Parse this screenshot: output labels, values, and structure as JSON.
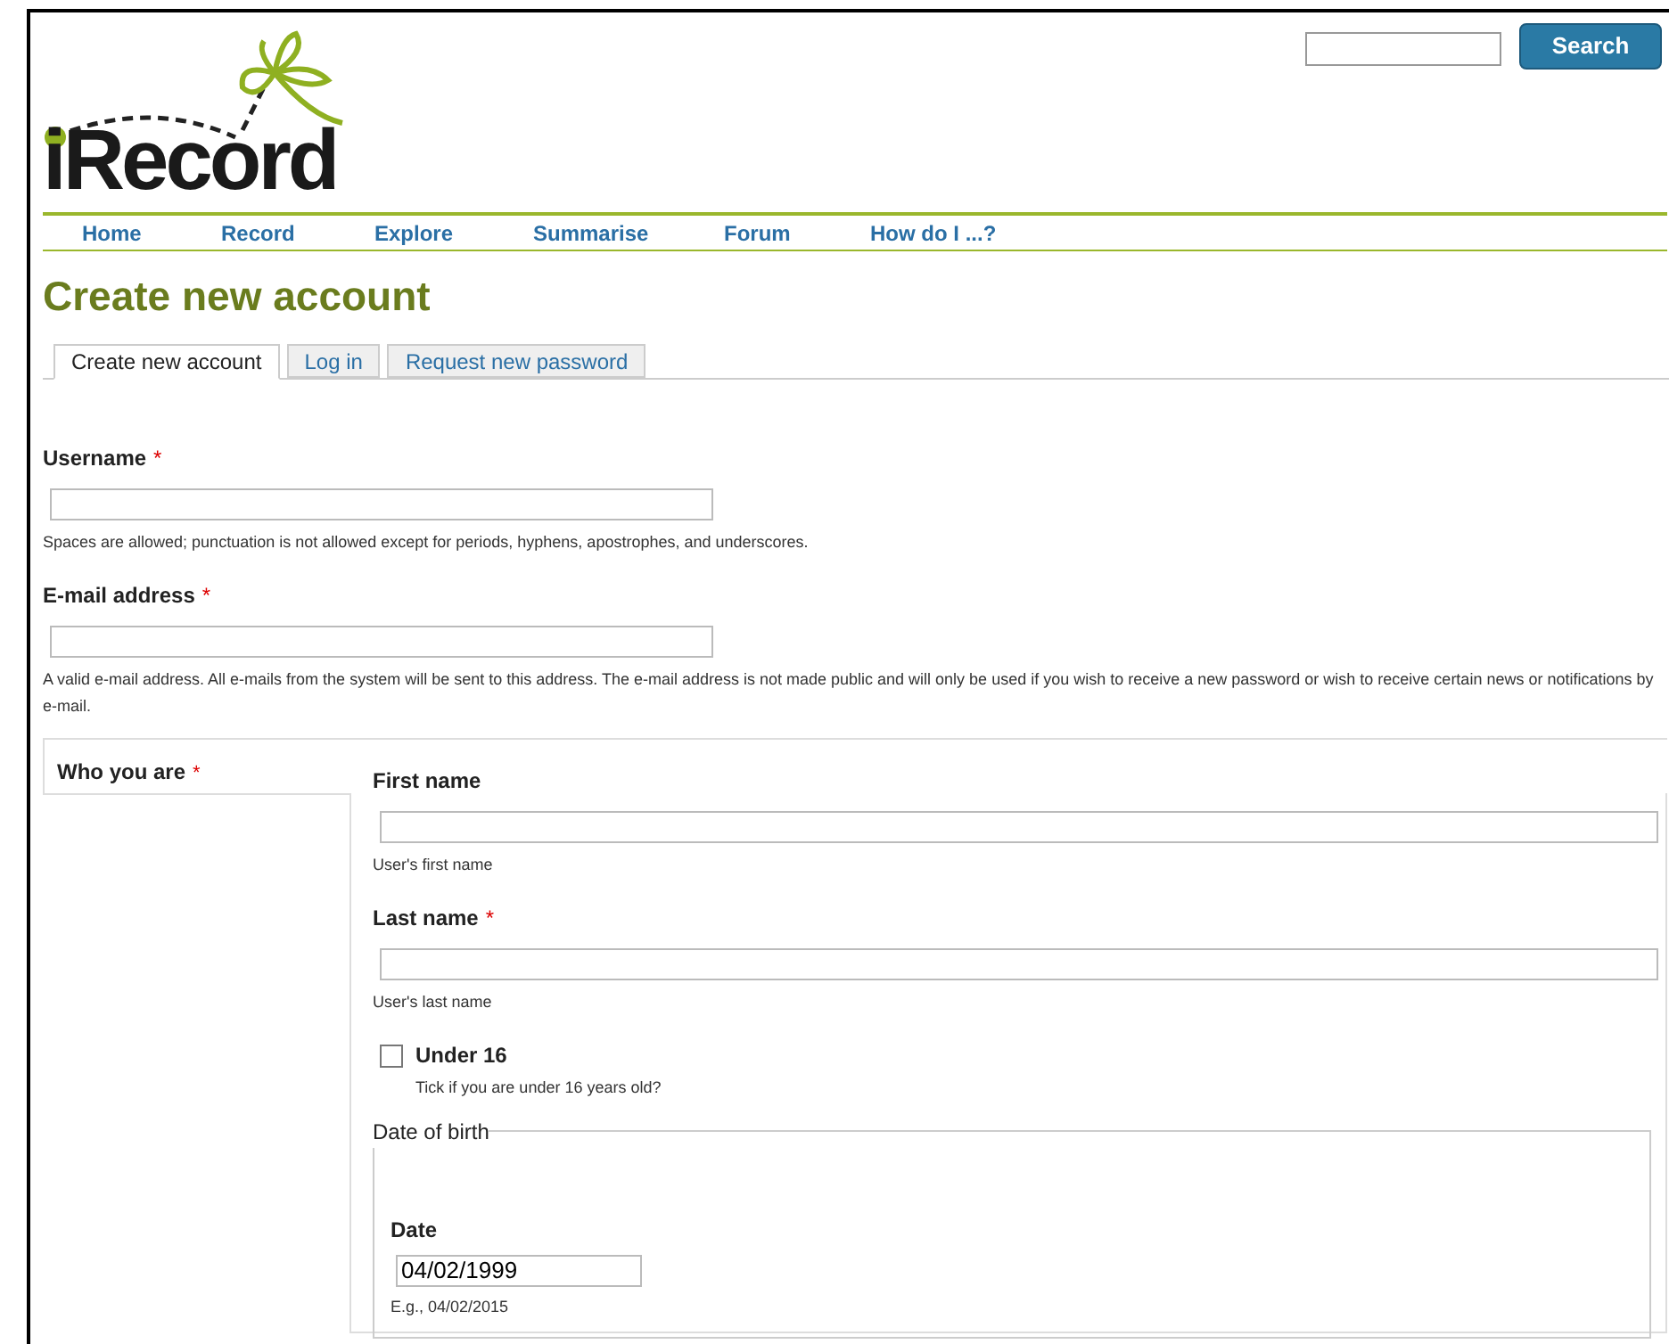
{
  "header": {
    "logo_text": "iRecord",
    "search": {
      "button": "Search"
    }
  },
  "nav": [
    {
      "label": "Home"
    },
    {
      "label": "Record"
    },
    {
      "label": "Explore"
    },
    {
      "label": "Summarise"
    },
    {
      "label": "Forum"
    },
    {
      "label": "How do I ...?"
    }
  ],
  "page_title": "Create new account",
  "tabs": [
    {
      "label": "Create new account",
      "selected": true
    },
    {
      "label": "Log in",
      "selected": false
    },
    {
      "label": "Request new password",
      "selected": false
    }
  ],
  "fields": [
    {
      "label": "Username",
      "required_mark": "*",
      "description": "Spaces are allowed; punctuation is not allowed except for periods, hyphens, apostrophes, and underscores."
    },
    {
      "label": "E-mail address",
      "required_mark": "*",
      "description": "A valid e-mail address. All e-mails from the system will be sent to this address. The e-mail address is not made public and will only be used if you wish to receive a new password or wish to receive certain news or notifications by e-mail."
    }
  ],
  "who_you_are": {
    "tab_label": "Who you are",
    "required_mark": "*",
    "fields": [
      {
        "label": "First name",
        "description": "User's first name"
      },
      {
        "label": "Last name",
        "required_mark": "*",
        "description": "User's last name"
      }
    ],
    "checkbox": {
      "label": "Under 16",
      "checked": false,
      "description": "Tick if you are under 16 years old?"
    },
    "date_of_birth": {
      "legend": "Date of birth",
      "label": "Date",
      "value": "04/02/1999",
      "description": "E.g., 04/02/2015"
    }
  }
}
